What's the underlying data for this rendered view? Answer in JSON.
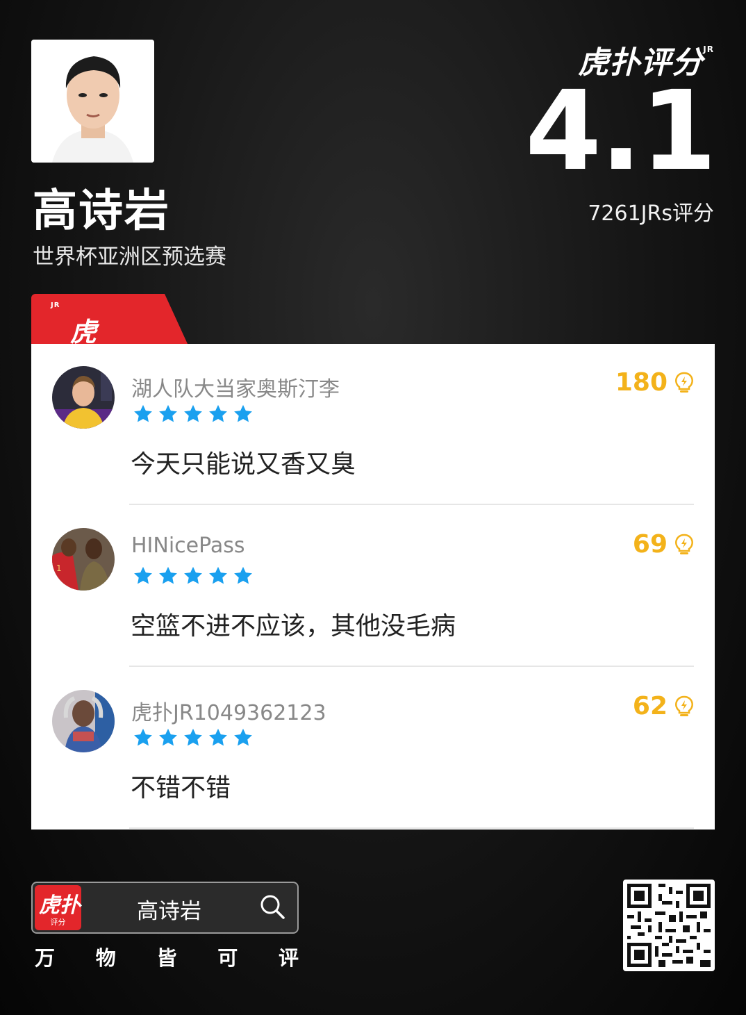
{
  "player": {
    "name": "高诗岩",
    "event": "世界杯亚洲区预选赛"
  },
  "rating": {
    "brand": "虎扑评分",
    "brand_sup": "JR",
    "score": "4.1",
    "votes_text": "7261JRs评分"
  },
  "section": {
    "tag": "虎扑亮回复",
    "tag_sup": "JR"
  },
  "comments": [
    {
      "user": "湖人队大当家奥斯汀李",
      "stars": 5,
      "likes": "180",
      "text": "今天只能说又香又臭"
    },
    {
      "user": "HINicePass",
      "stars": 5,
      "likes": "69",
      "text": "空篮不进不应该，其他没毛病"
    },
    {
      "user": "虎扑JR1049362123",
      "stars": 5,
      "likes": "62",
      "text": "不错不错"
    }
  ],
  "footer": {
    "app_icon_big": "虎扑",
    "app_icon_small": "评分",
    "search_text": "高诗岩",
    "tagline": [
      "万",
      "物",
      "皆",
      "可",
      "评"
    ]
  },
  "colors": {
    "accent_red": "#e3262b",
    "star_blue": "#1aa0ef",
    "likes_gold": "#f3b21a"
  },
  "icons": [
    "search-icon",
    "lightbulb-icon",
    "star-icon",
    "qr-code"
  ]
}
